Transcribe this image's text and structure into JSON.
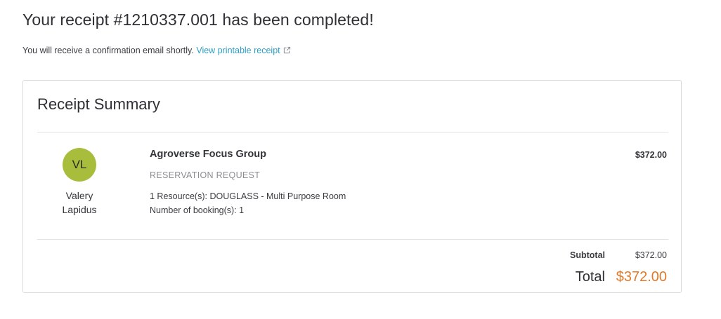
{
  "header": {
    "title": "Your receipt #1210337.001 has been completed!",
    "confirmation_text": "You will receive a confirmation email shortly.",
    "printable_link": "View printable receipt",
    "printable_icon": "external-link-icon"
  },
  "summary": {
    "title": "Receipt Summary",
    "person": {
      "initials": "VL",
      "first_name": "Valery",
      "last_name": "Lapidus",
      "avatar_color": "#a9bd3c"
    },
    "item": {
      "title": "Agroverse Focus Group",
      "type": "RESERVATION REQUEST",
      "resources": "1 Resource(s): DOUGLASS - Multi Purpose Room",
      "bookings": "Number of booking(s): 1",
      "price": "$372.00"
    },
    "subtotal_label": "Subtotal",
    "subtotal_value": "$372.00",
    "total_label": "Total",
    "total_value": "$372.00",
    "total_color": "#e07a2a",
    "link_color": "#2e9fc4"
  }
}
